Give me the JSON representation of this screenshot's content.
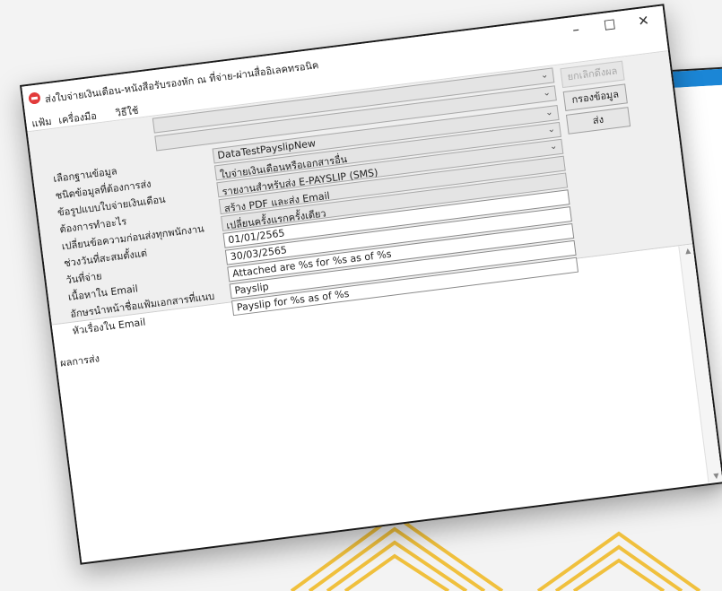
{
  "app": {
    "title": "ส่งใบจ่ายเงินเดือน-หนังสือรับรองหัก ณ ที่จ่าย-ผ่านสื่ออิเลคทรอนิค",
    "controls": {
      "minimize": "–",
      "maximize": "☐",
      "close": "✕"
    }
  },
  "menu": {
    "items": [
      "แฟ้ม",
      "เครื่องมือ",
      "วิธีใช้"
    ]
  },
  "form": {
    "rows": [
      {
        "label": "เลือกฐานข้อมูล",
        "value": "DataTestPayslipNew",
        "kind": "select"
      },
      {
        "label": "ชนิดข้อมูลที่ต้องการส่ง",
        "value": "ใบจ่ายเงินเดือนหรือเอกสารอื่น",
        "kind": "select"
      },
      {
        "label": "ข้อรูปแบบใบจ่ายเงินเดือน",
        "value": "รายงานสำหรับส่ง E-PAYSLIP (SMS)",
        "kind": "select"
      },
      {
        "label": "ต้องการทำอะไร",
        "value": "สร้าง PDF และส่ง Email",
        "kind": "select"
      },
      {
        "label": "เปลี่ยนข้อความก่อนส่งทุกพนักงาน",
        "value": "เปลี่ยนครั้งแรกครั้งเดียว",
        "kind": "select"
      },
      {
        "label": "ช่วงวันที่สะสมตั้งแต่",
        "value": "01/01/2565",
        "kind": "input"
      },
      {
        "label": "วันที่จ่าย",
        "value": "30/03/2565",
        "kind": "input"
      },
      {
        "label": "เนื้อหาใน Email",
        "value": "Attached are %s for %s as of %s",
        "kind": "input"
      },
      {
        "label": "อักษรนำหน้าชื่อแฟ้มเอกสารที่แนบ",
        "value": "Payslip",
        "kind": "input"
      },
      {
        "label": "หัวเรื่องใน Email",
        "value": "Payslip for %s as of %s",
        "kind": "input"
      }
    ],
    "extra_chevrons": 2,
    "buttons": {
      "cancel": "ยกเลิกดึงผล",
      "filter": "กรองข้อมูล",
      "send": "ส่ง"
    }
  },
  "results": {
    "label": "ผลการส่ง"
  },
  "colors": {
    "title_icon": "#e23b3b",
    "gold_accent": "#f0b81e",
    "back_window_bar": "#1b86d6"
  },
  "icons": {
    "app": "payslip-app-icon",
    "dropdown": "chevron-down-icon"
  }
}
